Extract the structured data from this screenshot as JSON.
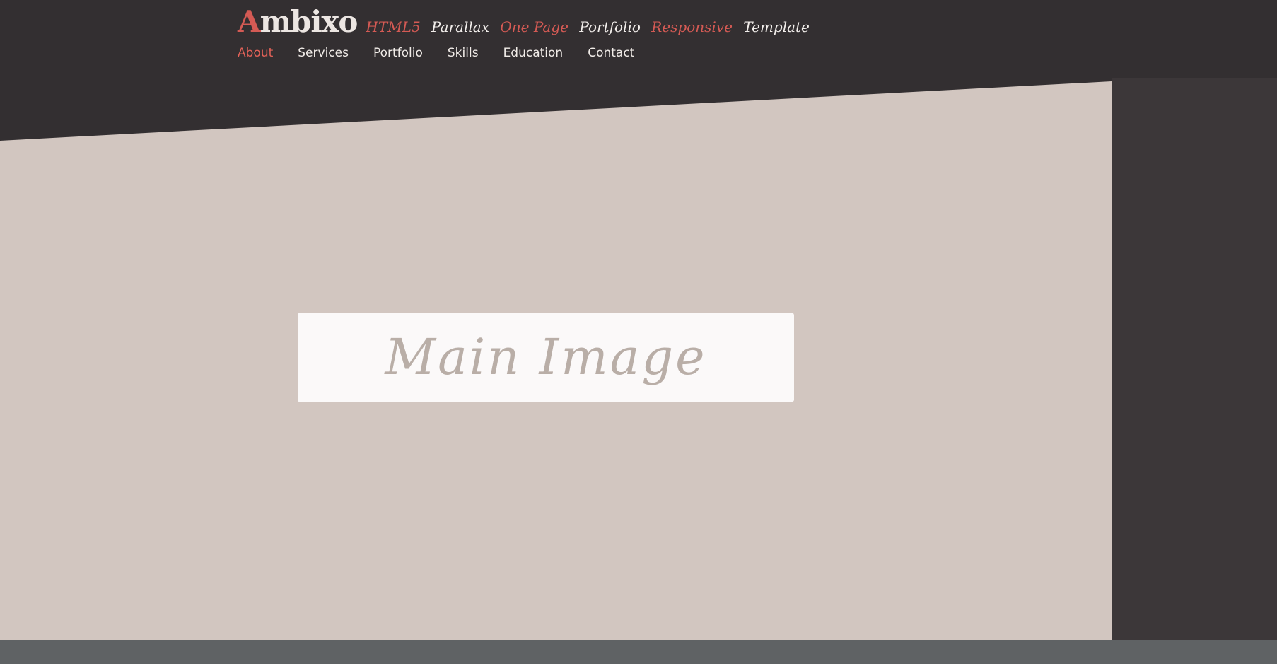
{
  "brand": {
    "logo_first_letter": "A",
    "logo_rest": "mbixo",
    "tagline_words": [
      "HTML5",
      "Parallax",
      "One Page",
      "Portfolio",
      "Responsive",
      "Template"
    ]
  },
  "nav": {
    "items": [
      "About",
      "Services",
      "Portfolio",
      "Skills",
      "Education",
      "Contact"
    ],
    "active_item": "About"
  },
  "hero": {
    "image_label": "Main Image"
  },
  "colors": {
    "header_bg": "#332f31",
    "hero_bg": "#d2c6c0",
    "right_panel": "#3c3739",
    "accent_red": "#d45a54",
    "light_text": "#f1ece8",
    "image_box": "#fbf9f9",
    "image_text": "#b9aea7",
    "footer_bar": "#5f6264"
  }
}
